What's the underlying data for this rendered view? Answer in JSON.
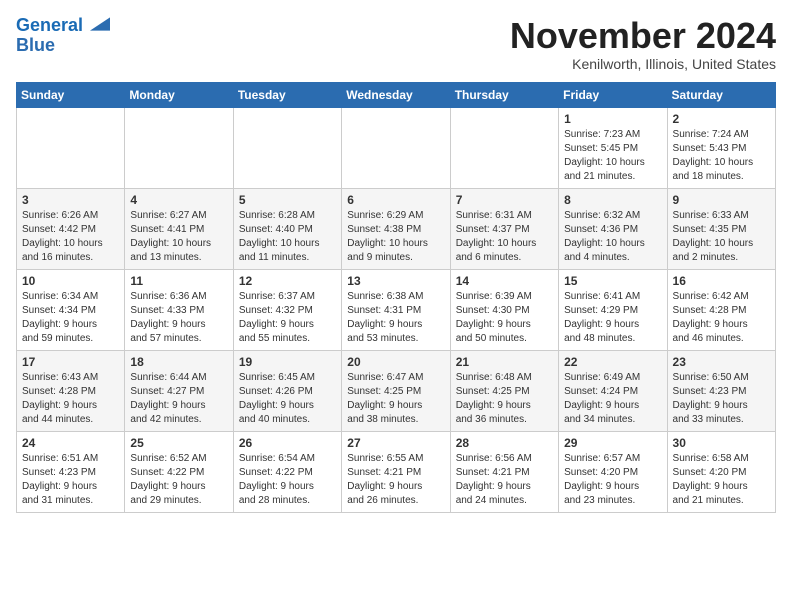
{
  "logo": {
    "line1": "General",
    "line2": "Blue"
  },
  "title": "November 2024",
  "location": "Kenilworth, Illinois, United States",
  "header_days": [
    "Sunday",
    "Monday",
    "Tuesday",
    "Wednesday",
    "Thursday",
    "Friday",
    "Saturday"
  ],
  "weeks": [
    [
      {
        "day": "",
        "info": ""
      },
      {
        "day": "",
        "info": ""
      },
      {
        "day": "",
        "info": ""
      },
      {
        "day": "",
        "info": ""
      },
      {
        "day": "",
        "info": ""
      },
      {
        "day": "1",
        "info": "Sunrise: 7:23 AM\nSunset: 5:45 PM\nDaylight: 10 hours\nand 21 minutes."
      },
      {
        "day": "2",
        "info": "Sunrise: 7:24 AM\nSunset: 5:43 PM\nDaylight: 10 hours\nand 18 minutes."
      }
    ],
    [
      {
        "day": "3",
        "info": "Sunrise: 6:26 AM\nSunset: 4:42 PM\nDaylight: 10 hours\nand 16 minutes."
      },
      {
        "day": "4",
        "info": "Sunrise: 6:27 AM\nSunset: 4:41 PM\nDaylight: 10 hours\nand 13 minutes."
      },
      {
        "day": "5",
        "info": "Sunrise: 6:28 AM\nSunset: 4:40 PM\nDaylight: 10 hours\nand 11 minutes."
      },
      {
        "day": "6",
        "info": "Sunrise: 6:29 AM\nSunset: 4:38 PM\nDaylight: 10 hours\nand 9 minutes."
      },
      {
        "day": "7",
        "info": "Sunrise: 6:31 AM\nSunset: 4:37 PM\nDaylight: 10 hours\nand 6 minutes."
      },
      {
        "day": "8",
        "info": "Sunrise: 6:32 AM\nSunset: 4:36 PM\nDaylight: 10 hours\nand 4 minutes."
      },
      {
        "day": "9",
        "info": "Sunrise: 6:33 AM\nSunset: 4:35 PM\nDaylight: 10 hours\nand 2 minutes."
      }
    ],
    [
      {
        "day": "10",
        "info": "Sunrise: 6:34 AM\nSunset: 4:34 PM\nDaylight: 9 hours\nand 59 minutes."
      },
      {
        "day": "11",
        "info": "Sunrise: 6:36 AM\nSunset: 4:33 PM\nDaylight: 9 hours\nand 57 minutes."
      },
      {
        "day": "12",
        "info": "Sunrise: 6:37 AM\nSunset: 4:32 PM\nDaylight: 9 hours\nand 55 minutes."
      },
      {
        "day": "13",
        "info": "Sunrise: 6:38 AM\nSunset: 4:31 PM\nDaylight: 9 hours\nand 53 minutes."
      },
      {
        "day": "14",
        "info": "Sunrise: 6:39 AM\nSunset: 4:30 PM\nDaylight: 9 hours\nand 50 minutes."
      },
      {
        "day": "15",
        "info": "Sunrise: 6:41 AM\nSunset: 4:29 PM\nDaylight: 9 hours\nand 48 minutes."
      },
      {
        "day": "16",
        "info": "Sunrise: 6:42 AM\nSunset: 4:28 PM\nDaylight: 9 hours\nand 46 minutes."
      }
    ],
    [
      {
        "day": "17",
        "info": "Sunrise: 6:43 AM\nSunset: 4:28 PM\nDaylight: 9 hours\nand 44 minutes."
      },
      {
        "day": "18",
        "info": "Sunrise: 6:44 AM\nSunset: 4:27 PM\nDaylight: 9 hours\nand 42 minutes."
      },
      {
        "day": "19",
        "info": "Sunrise: 6:45 AM\nSunset: 4:26 PM\nDaylight: 9 hours\nand 40 minutes."
      },
      {
        "day": "20",
        "info": "Sunrise: 6:47 AM\nSunset: 4:25 PM\nDaylight: 9 hours\nand 38 minutes."
      },
      {
        "day": "21",
        "info": "Sunrise: 6:48 AM\nSunset: 4:25 PM\nDaylight: 9 hours\nand 36 minutes."
      },
      {
        "day": "22",
        "info": "Sunrise: 6:49 AM\nSunset: 4:24 PM\nDaylight: 9 hours\nand 34 minutes."
      },
      {
        "day": "23",
        "info": "Sunrise: 6:50 AM\nSunset: 4:23 PM\nDaylight: 9 hours\nand 33 minutes."
      }
    ],
    [
      {
        "day": "24",
        "info": "Sunrise: 6:51 AM\nSunset: 4:23 PM\nDaylight: 9 hours\nand 31 minutes."
      },
      {
        "day": "25",
        "info": "Sunrise: 6:52 AM\nSunset: 4:22 PM\nDaylight: 9 hours\nand 29 minutes."
      },
      {
        "day": "26",
        "info": "Sunrise: 6:54 AM\nSunset: 4:22 PM\nDaylight: 9 hours\nand 28 minutes."
      },
      {
        "day": "27",
        "info": "Sunrise: 6:55 AM\nSunset: 4:21 PM\nDaylight: 9 hours\nand 26 minutes."
      },
      {
        "day": "28",
        "info": "Sunrise: 6:56 AM\nSunset: 4:21 PM\nDaylight: 9 hours\nand 24 minutes."
      },
      {
        "day": "29",
        "info": "Sunrise: 6:57 AM\nSunset: 4:20 PM\nDaylight: 9 hours\nand 23 minutes."
      },
      {
        "day": "30",
        "info": "Sunrise: 6:58 AM\nSunset: 4:20 PM\nDaylight: 9 hours\nand 21 minutes."
      }
    ]
  ]
}
